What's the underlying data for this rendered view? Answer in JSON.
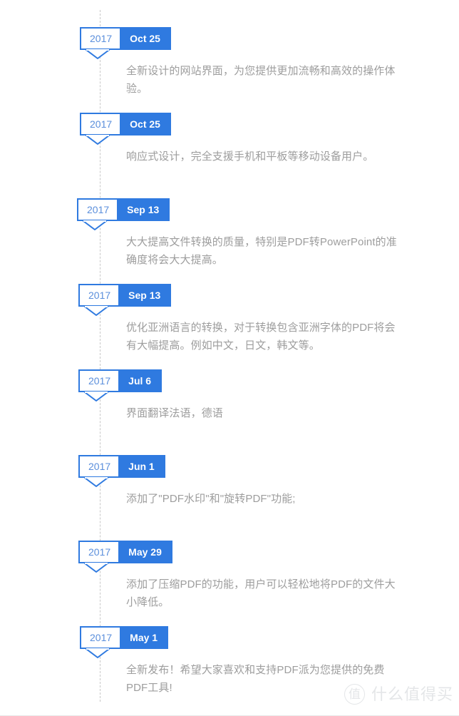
{
  "theme": {
    "accent": "#2f7ae0",
    "year_text": "#5b8fdc",
    "description_text": "#9d9d9d",
    "spine": "#c8c8c8",
    "background": "#ffffff",
    "watermark": "#e4e6e8"
  },
  "timeline": {
    "entries": [
      {
        "year": "2017",
        "date": "Oct 25",
        "description": "全新设计的网站界面，为您提供更加流畅和高效的操作体验。"
      },
      {
        "year": "2017",
        "date": "Oct 25",
        "description": "响应式设计，完全支援手机和平板等移动设备用户。"
      },
      {
        "year": "2017",
        "date": "Sep 13",
        "description": "大大提高文件转换的质量，特别是PDF转PowerPoint的准确度将会大大提高。"
      },
      {
        "year": "2017",
        "date": "Sep 13",
        "description": "优化亚洲语言的转换，对于转换包含亚洲字体的PDF将会有大幅提高。例如中文，日文，韩文等。"
      },
      {
        "year": "2017",
        "date": "Jul 6",
        "description": "界面翻译法语，德语"
      },
      {
        "year": "2017",
        "date": "Jun 1",
        "description": "添加了\"PDF水印\"和\"旋转PDF\"功能;"
      },
      {
        "year": "2017",
        "date": "May 29",
        "description": "添加了压缩PDF的功能，用户可以轻松地将PDF的文件大小降低。"
      },
      {
        "year": "2017",
        "date": "May 1",
        "description": "全新发布！希望大家喜欢和支持PDF派为您提供的免费PDF工具!"
      }
    ]
  },
  "watermark": {
    "mark": "值",
    "text": "什么值得买"
  }
}
